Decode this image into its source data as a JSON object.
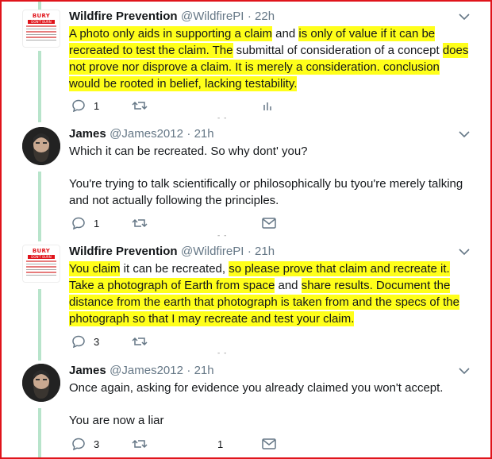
{
  "tweets": [
    {
      "author": "Wildfire Prevention",
      "handle": "@WildfirePI",
      "time": "· 22h",
      "avatar": "bury-dont-burn-logo",
      "logo_text": "BURY",
      "logo_sub": "DON'T BURN",
      "text": "A photo only aids in supporting a claim and is only of value if it can be recreated to test the claim. The submittal of consideration of a concept does not prove nor disprove a claim. It is merely a consideration. conclusion would be rooted in belief, lacking testability.",
      "reply_count": "1",
      "retweet_count": "",
      "like_count": "",
      "divider": "- -"
    },
    {
      "author": "James",
      "handle": "@James2012",
      "time": "· 21h",
      "avatar": "bearded-man-photo",
      "paragraphs": [
        "Which it can be recreated. So why dont' you?",
        "You're trying to talk scientifically or philosophically bu tyou're merely talking and not actually following the principles."
      ],
      "reply_count": "1",
      "retweet_count": "",
      "divider": "- -"
    },
    {
      "author": "Wildfire Prevention",
      "handle": "@WildfirePI",
      "time": "· 21h",
      "avatar": "bury-dont-burn-logo",
      "logo_text": "BURY",
      "logo_sub": "DON'T BURN",
      "text": "You claim it can be recreated, so please prove that claim and recreate it. Take a photograph of Earth from space and share results. Document the distance from the earth that photograph is taken from and the specs of the photograph so that I may recreate and test your claim.",
      "reply_count": "3",
      "retweet_count": "",
      "divider": "- -"
    },
    {
      "author": "James",
      "handle": "@James2012",
      "time": "· 21h",
      "avatar": "bearded-man-photo",
      "paragraphs": [
        "Once again, asking for evidence you already claimed you won't accept.",
        "You are now a liar"
      ],
      "reply_count": "3",
      "retweet_count": "",
      "like_count": "1"
    }
  ],
  "colors": {
    "highlight": "#ffff1a",
    "thread_line": "#b8e4cb",
    "border": "#e0141b",
    "meta_text": "#657786"
  }
}
